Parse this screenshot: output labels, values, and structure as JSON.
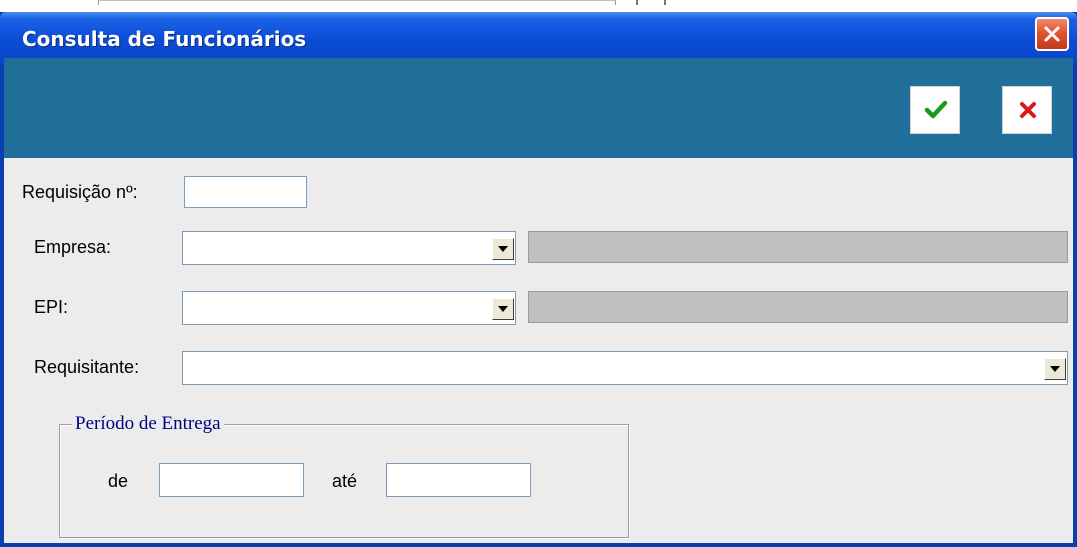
{
  "window": {
    "title": "Consulta de Funcionários",
    "close_icon": "close-icon"
  },
  "toolbar": {
    "ok_icon": "checkmark-icon",
    "ok_color": "#1a9a1a",
    "cancel_icon": "x-icon",
    "cancel_color": "#d81a1a",
    "background": "#1f6f9a"
  },
  "form": {
    "requisicao_label": "Requisição nº:",
    "requisicao_value": "",
    "empresa_label": "Empresa:",
    "empresa_value": "",
    "empresa_desc": "",
    "epi_label": "EPI:",
    "epi_value": "",
    "epi_desc": "",
    "requisitante_label": "Requisitante:",
    "requisitante_value": ""
  },
  "periodo": {
    "title": "Período de Entrega",
    "de_label": "de",
    "de_value": "",
    "ate_label": "até",
    "ate_value": ""
  }
}
